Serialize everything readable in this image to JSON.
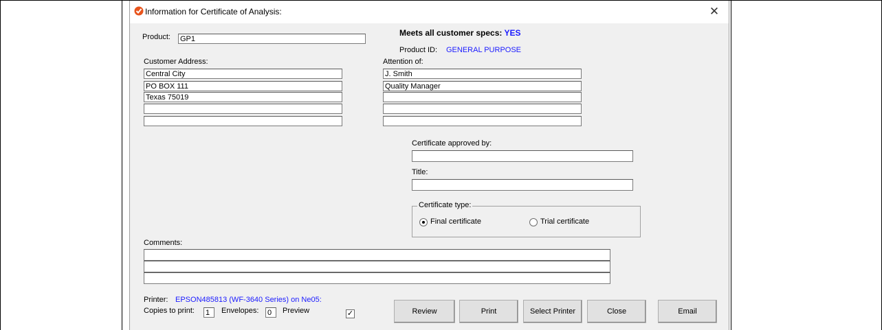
{
  "window": {
    "title": "Information for Certificate of Analysis:"
  },
  "product": {
    "label": "Product:",
    "value": "GP1"
  },
  "specs": {
    "label": "Meets all customer specs:",
    "value": "YES"
  },
  "product_id": {
    "label": "Product ID:",
    "value": "GENERAL PURPOSE"
  },
  "customer_address": {
    "label": "Customer Address:",
    "lines": [
      "Central City",
      "PO BOX 111",
      "Texas 75019",
      "",
      ""
    ]
  },
  "attention": {
    "label": "Attention of:",
    "lines": [
      "J. Smith",
      "Quality Manager",
      "",
      "",
      ""
    ]
  },
  "approved_by": {
    "label": "Certificate approved by:",
    "value": ""
  },
  "title_field": {
    "label": "Title:",
    "value": ""
  },
  "certificate_type": {
    "label": "Certificate type:",
    "final_label": "Final certificate",
    "trial_label": "Trial certificate",
    "selected": "final"
  },
  "comments": {
    "label": "Comments:",
    "lines": [
      "",
      "",
      ""
    ]
  },
  "printer": {
    "label": "Printer:",
    "value": "EPSON485813 (WF-3640 Series) on Ne05:"
  },
  "copies": {
    "label": "Copies to print:",
    "value": "1"
  },
  "envelopes": {
    "label": "Envelopes:",
    "value": "0"
  },
  "preview": {
    "label": "Preview",
    "checked": true
  },
  "buttons": {
    "review": "Review",
    "print": "Print",
    "select_printer": "Select Printer",
    "close": "Close",
    "email": "Email"
  },
  "colors": {
    "accent": "#1a1aff",
    "dialog_bg": "#f0f0f0"
  },
  "icons": {
    "app": "app-logo-icon",
    "close": "close-icon",
    "check": "checkmark-icon",
    "radio_dot": "radio-dot-icon"
  }
}
